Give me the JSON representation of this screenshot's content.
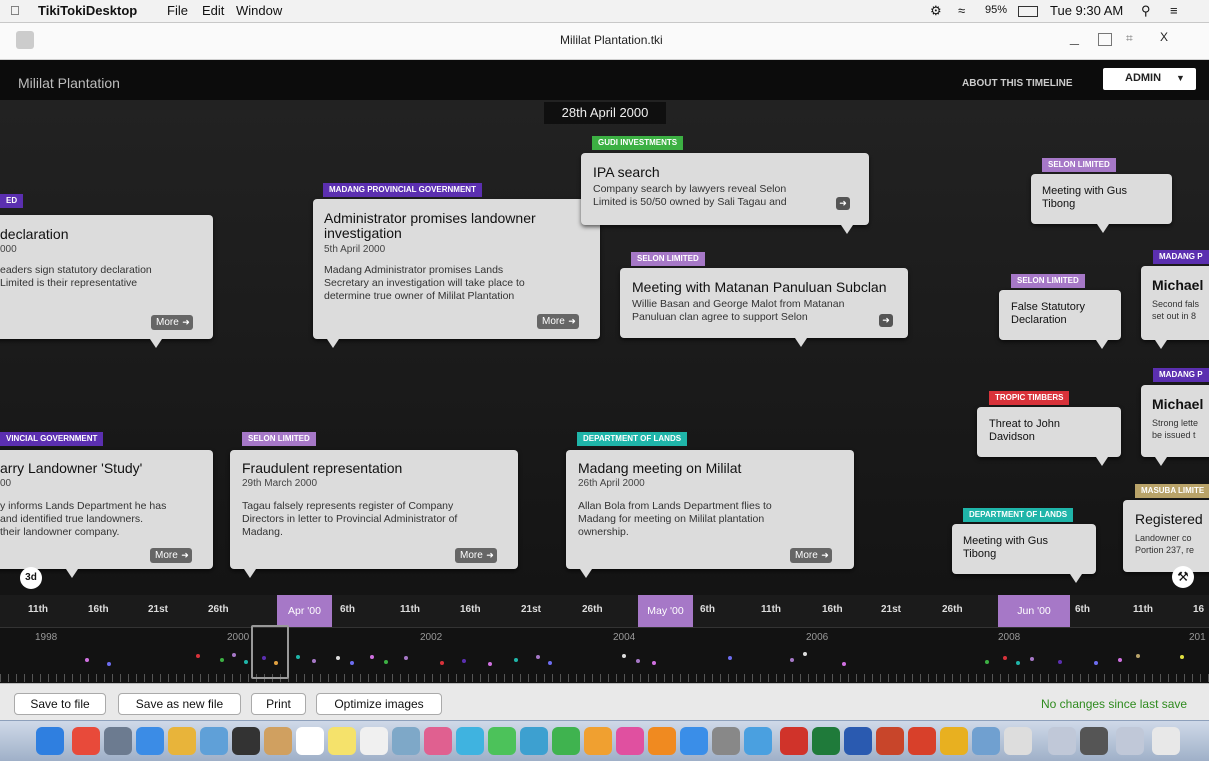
{
  "menubar": {
    "app_name": "TikiTokiDesktop",
    "menus": [
      "File",
      "Edit",
      "Window"
    ],
    "battery": "95%",
    "clock": "Tue 9:30 AM"
  },
  "window": {
    "file_title": "Mililat Plantation.tki",
    "close_label": "X"
  },
  "header": {
    "title": "Mililat Plantation",
    "about_label": "ABOUT THIS TIMELINE",
    "admin_label": "ADMIN"
  },
  "current_date": "28th April 2000",
  "cards": [
    {
      "tag": "ED",
      "tag_color": "#5b2fb0",
      "title": "declaration",
      "date": "000",
      "text": [
        "eaders sign statutory declaration",
        "Limited is their representative"
      ],
      "more": "More"
    },
    {
      "tag": "MADANG PROVINCIAL GOVERNMENT",
      "tag_color": "#5b2fb0",
      "title": "Administrator promises landowner investigation",
      "date": "5th April 2000",
      "text": [
        "Madang Administrator promises Lands",
        "Secretary an investigation will take place to",
        "determine true owner of Mililat Plantation"
      ],
      "more": "More"
    },
    {
      "tag": "GUDI INVESTMENTS",
      "tag_color": "#3cb043",
      "title": "IPA search",
      "date": "",
      "text": [
        "Company search by lawyers reveal Selon",
        "Limited is 50/50 owned by Sali Tagau and"
      ],
      "more": ""
    },
    {
      "tag": "SELON LIMITED",
      "tag_color": "#a678c7",
      "title": "Meeting with Matanan Panuluan Subclan",
      "date": "",
      "text": [
        "Willie Basan and George Malot from Matanan",
        "Panuluan clan agree to support Selon"
      ],
      "more": ""
    },
    {
      "tag": "SELON LIMITED",
      "tag_color": "#a678c7",
      "title": "Meeting with Gus Tibong",
      "date": "",
      "text": [],
      "more": ""
    },
    {
      "tag": "SELON LIMITED",
      "tag_color": "#a678c7",
      "title": "False Statutory Declaration",
      "date": "",
      "text": [],
      "more": ""
    },
    {
      "tag": "MADANG P",
      "tag_color": "#5b2fb0",
      "title": "Michael",
      "date": "",
      "text": [
        "Second fals",
        "set out in 8"
      ],
      "more": ""
    },
    {
      "tag": "TROPIC TIMBERS",
      "tag_color": "#d8323a",
      "title": "Threat to John Davidson",
      "date": "",
      "text": [],
      "more": ""
    },
    {
      "tag": "MADANG P",
      "tag_color": "#5b2fb0",
      "title": "Michael",
      "date": "",
      "text": [
        "Strong lette",
        "be issued t"
      ],
      "more": ""
    },
    {
      "tag": "VINCIAL GOVERNMENT",
      "tag_color": "#5b2fb0",
      "title": "arry Landowner 'Study'",
      "date": "00",
      "text": [
        "y informs Lands Department he has",
        "and identified true landowners.",
        "their landowner company."
      ],
      "more": "More"
    },
    {
      "tag": "SELON LIMITED",
      "tag_color": "#a678c7",
      "title": "Fraudulent representation",
      "date": "29th March 2000",
      "text": [
        "Tagau falsely represents register of Company",
        "Directors in letter to Provincial Administrator of",
        "Madang."
      ],
      "more": "More"
    },
    {
      "tag": "DEPARTMENT OF LANDS",
      "tag_color": "#1fb5a9",
      "title": "Madang meeting on Mililat",
      "date": "26th April 2000",
      "text": [
        "Allan Bola from Lands Department flies to",
        "Madang for meeting on Mililat plantation",
        "ownership."
      ],
      "more": "More"
    },
    {
      "tag": "DEPARTMENT OF LANDS",
      "tag_color": "#1fb5a9",
      "title": "Meeting with Gus Tibong",
      "date": "",
      "text": [],
      "more": ""
    },
    {
      "tag": "MASUBA LIMITE",
      "tag_color": "#b9a369",
      "title": "Registered",
      "date": "",
      "text": [
        "Landowner co",
        "Portion 237, re"
      ],
      "more": ""
    }
  ],
  "threed_label": "3d",
  "ruler": {
    "ticks": [
      "11th",
      "16th",
      "21st",
      "26th",
      "6th",
      "11th",
      "16th",
      "21st",
      "26th",
      "6th",
      "11th",
      "16th",
      "21st",
      "26th",
      "6th",
      "11th",
      "16"
    ],
    "months": [
      "Apr '00",
      "May '00",
      "Jun '00"
    ]
  },
  "overview_years": [
    "1998",
    "2000",
    "2002",
    "2004",
    "2006",
    "2008",
    "201"
  ],
  "bottom": {
    "buttons": [
      "Save to file",
      "Save as new file",
      "Print",
      "Optimize images"
    ],
    "status": "No changes since last save",
    "status_color": "#2e8b1e"
  }
}
